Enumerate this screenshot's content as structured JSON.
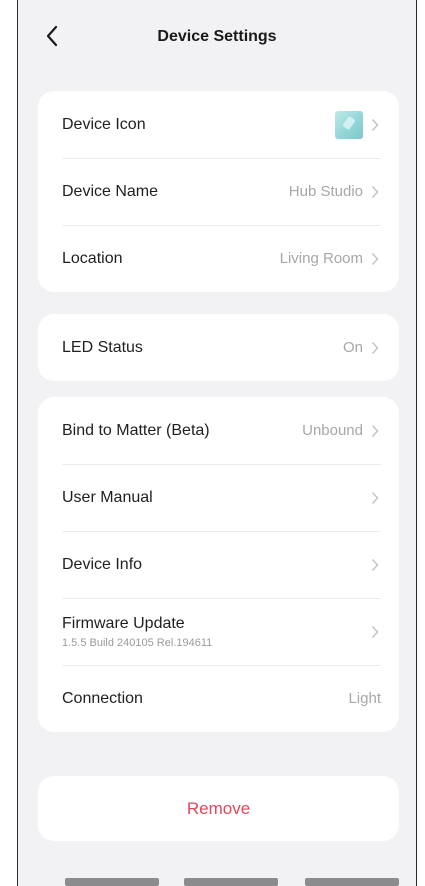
{
  "header": {
    "title": "Device Settings",
    "back_icon": "chevron-left-icon"
  },
  "group1": {
    "device_icon": {
      "label": "Device Icon",
      "thumb_color": "#8fd4d6"
    },
    "device_name": {
      "label": "Device Name",
      "value": "Hub Studio"
    },
    "location": {
      "label": "Location",
      "value": "Living Room"
    }
  },
  "group2": {
    "led_status": {
      "label": "LED Status",
      "value": "On"
    }
  },
  "group3": {
    "bind_matter": {
      "label": "Bind to Matter (Beta)",
      "value": "Unbound"
    },
    "user_manual": {
      "label": "User Manual"
    },
    "device_info": {
      "label": "Device Info"
    },
    "firmware": {
      "label": "Firmware Update",
      "sub": "1.5.5 Build 240105 Rel.194611"
    },
    "connection": {
      "label": "Connection",
      "value": "Light"
    }
  },
  "remove": {
    "label": "Remove",
    "color": "#e0475b"
  },
  "colors": {
    "background": "#f2f2f4",
    "card": "#ffffff",
    "secondary_text": "#a7a7a9"
  }
}
